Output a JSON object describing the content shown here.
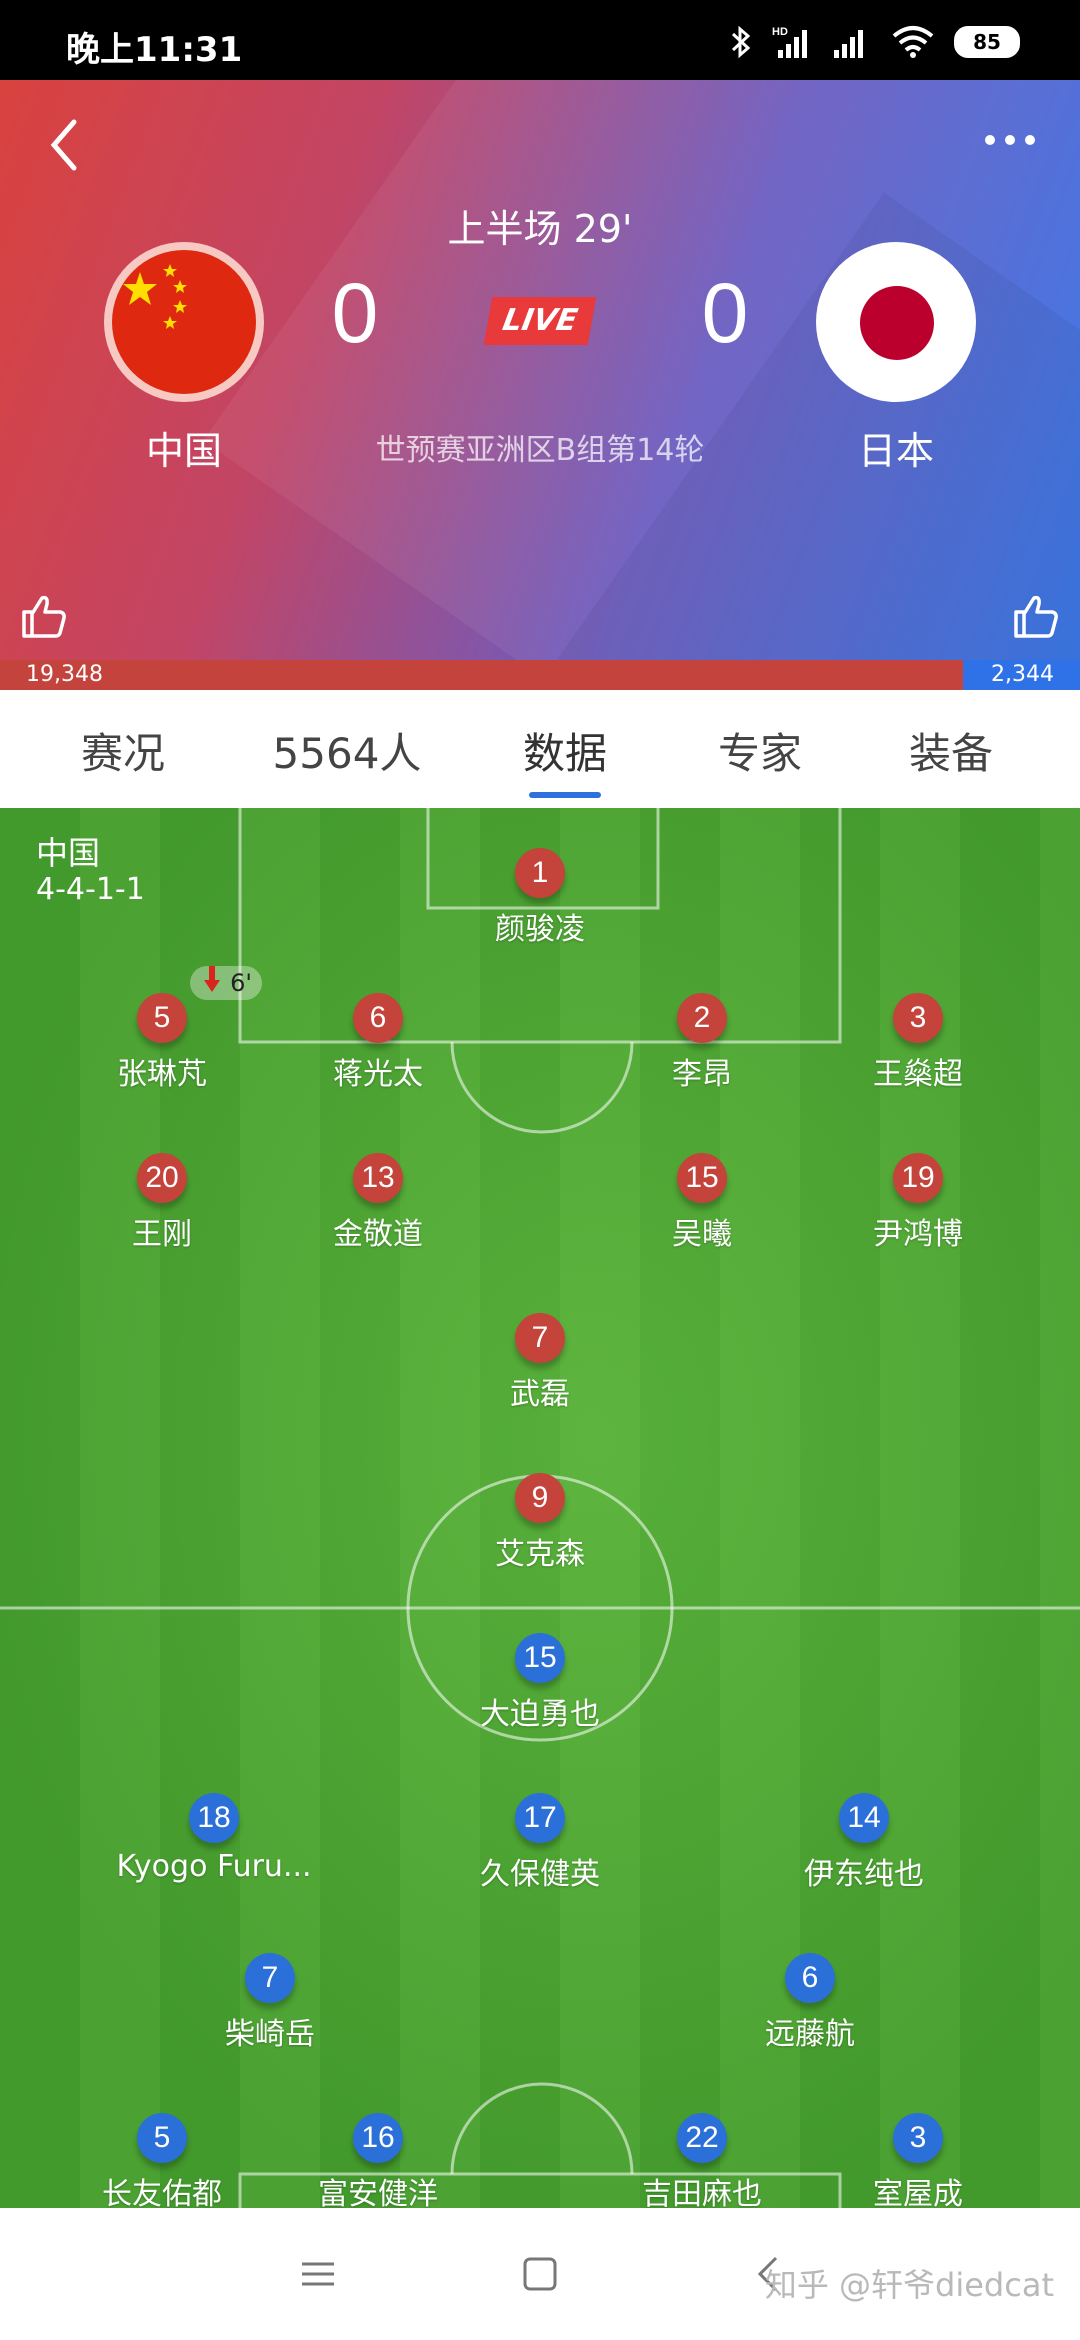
{
  "status_bar": {
    "time": "晚上11:31",
    "battery": "85"
  },
  "match": {
    "period_time": "上半场 29'",
    "live_label": "LIVE",
    "competition": "世预赛亚洲区B组第14轮",
    "home": {
      "name": "中国",
      "score": "0",
      "flag_icon": "china-flag-icon"
    },
    "away": {
      "name": "日本",
      "score": "0",
      "flag_icon": "japan-flag-icon"
    }
  },
  "votes": {
    "home": "19,348",
    "away": "2,344",
    "home_share": 0.892
  },
  "tabs": [
    {
      "label": "赛况",
      "active": false
    },
    {
      "label": "5564人",
      "active": false
    },
    {
      "label": "数据",
      "active": true
    },
    {
      "label": "专家",
      "active": false
    },
    {
      "label": "装备",
      "active": false
    }
  ],
  "formation": {
    "team": "中国",
    "shape": "4-4-1-1"
  },
  "home_players": [
    {
      "number": "1",
      "name": "颜骏凌"
    },
    {
      "number": "5",
      "name": "张琳芃",
      "sub_minute": "6'"
    },
    {
      "number": "6",
      "name": "蒋光太"
    },
    {
      "number": "2",
      "name": "李昂"
    },
    {
      "number": "3",
      "name": "王燊超"
    },
    {
      "number": "20",
      "name": "王刚"
    },
    {
      "number": "13",
      "name": "金敬道"
    },
    {
      "number": "15",
      "name": "吴曦"
    },
    {
      "number": "19",
      "name": "尹鸿博"
    },
    {
      "number": "7",
      "name": "武磊"
    },
    {
      "number": "9",
      "name": "艾克森"
    }
  ],
  "away_players": [
    {
      "number": "15",
      "name": "大迫勇也"
    },
    {
      "number": "18",
      "name": "Kyogo Furu..."
    },
    {
      "number": "17",
      "name": "久保健英"
    },
    {
      "number": "14",
      "name": "伊东纯也"
    },
    {
      "number": "7",
      "name": "柴崎岳"
    },
    {
      "number": "6",
      "name": "远藤航"
    },
    {
      "number": "5",
      "name": "长友佑都"
    },
    {
      "number": "16",
      "name": "富安健洋"
    },
    {
      "number": "22",
      "name": "吉田麻也"
    },
    {
      "number": "3",
      "name": "室屋成"
    }
  ],
  "watermark": "知乎 @轩爷diedcat",
  "colors": {
    "home_accent": "#c4433a",
    "away_accent": "#2b6fd9",
    "tab_indicator": "#2f6fde"
  }
}
